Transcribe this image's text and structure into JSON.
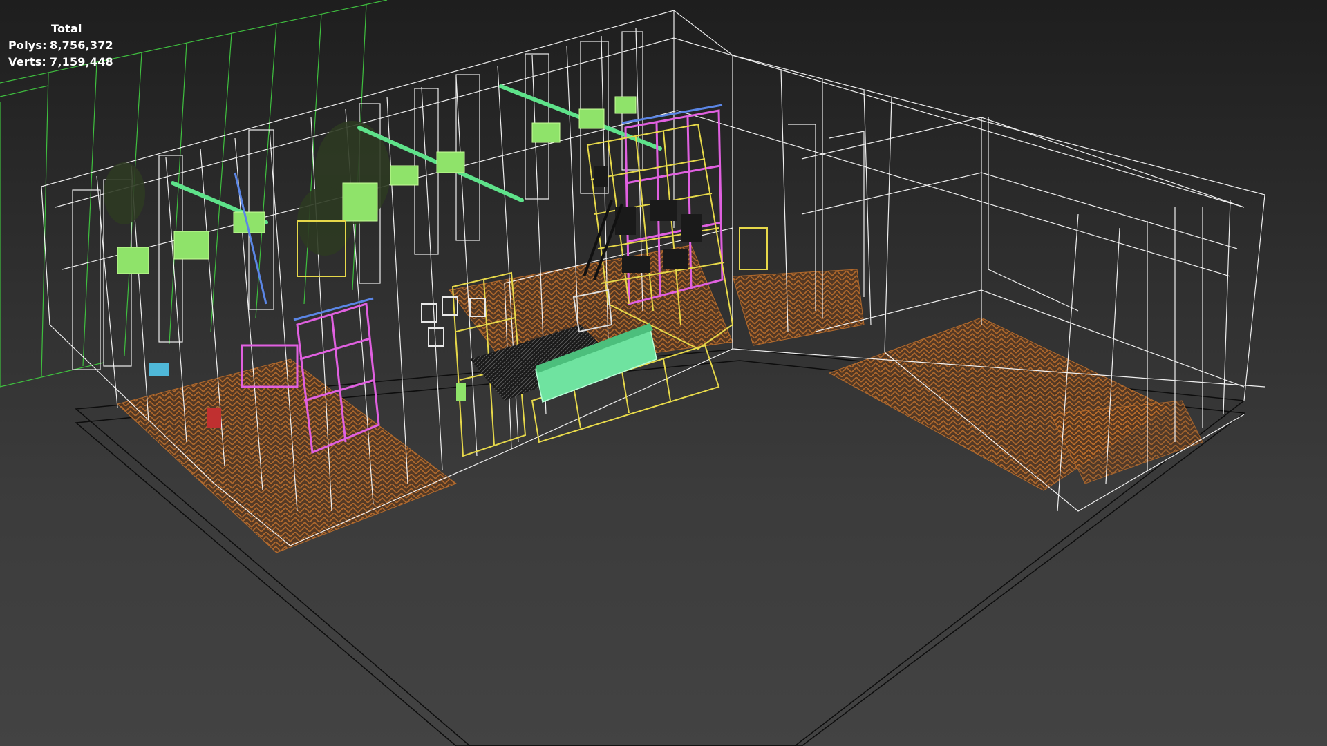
{
  "viewport": {
    "type": "3d-perspective-viewport",
    "display_mode": "wireframe",
    "colors": {
      "background_top": "#1e1e1e",
      "background_bottom": "#434343",
      "grid": "#3fbf3f",
      "wire": "#ffffff",
      "floor": "#c8742c",
      "shelving": "#e6d84a",
      "partition": "#e060e0",
      "rail": "#5ee28a",
      "sofa": "#6fe3a0",
      "screen": "#8fe36a",
      "glass": "#5b86e6"
    },
    "objects": [
      "grid-lines",
      "base-slab",
      "walls",
      "herringbone-floor",
      "shelving-unit",
      "glass-partition",
      "ceiling-rails",
      "sofa",
      "armchair",
      "dining-chairs",
      "plants"
    ]
  },
  "stats": {
    "title": "Total",
    "polys_label": "Polys:",
    "polys_value": "8,756,372",
    "verts_label": "Verts:",
    "verts_value": "7,159,448"
  }
}
